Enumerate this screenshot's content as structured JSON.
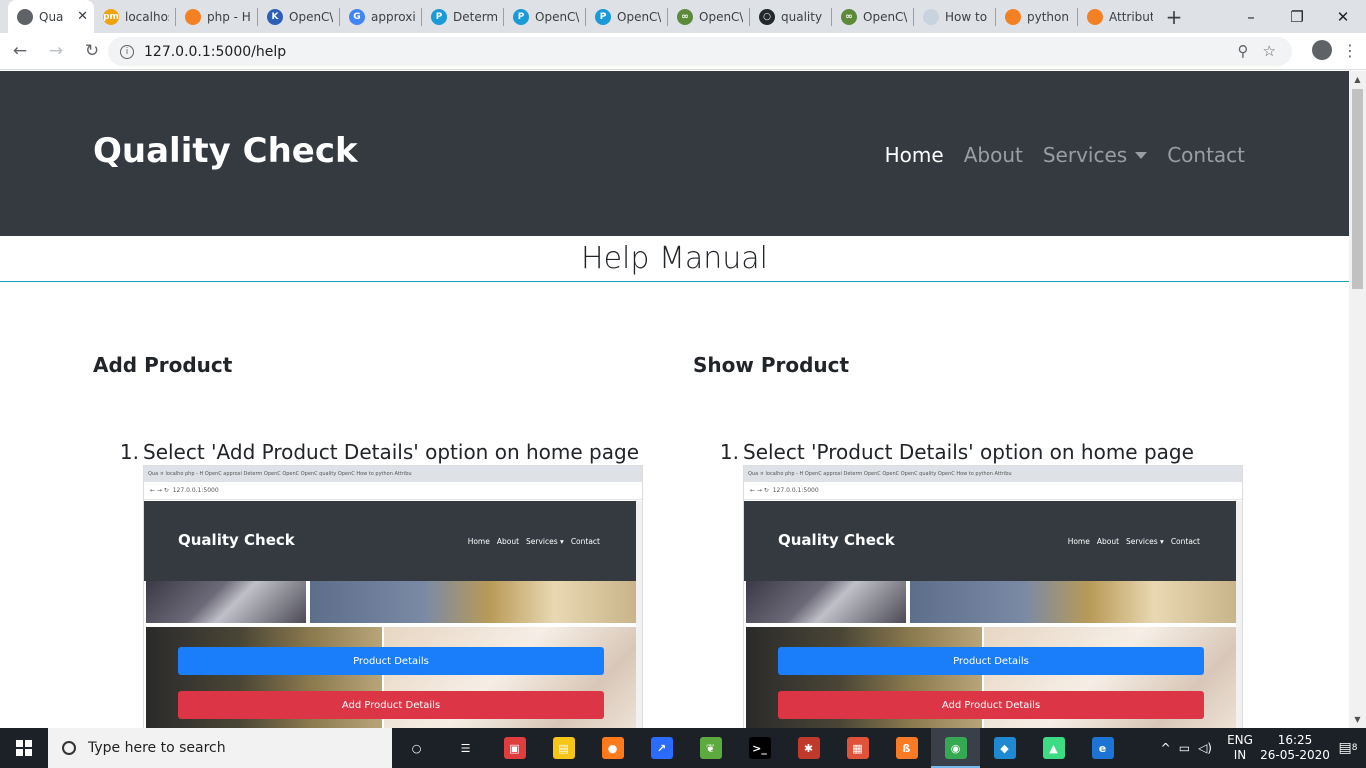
{
  "browser": {
    "tabs": [
      {
        "title": "Qua",
        "active": true,
        "color": "#5f6368",
        "glyph": ""
      },
      {
        "title": "localhos",
        "color": "#f0a20a",
        "glyph": "pm"
      },
      {
        "title": "php - H",
        "color": "#f48024",
        "glyph": ""
      },
      {
        "title": "OpenC\\",
        "color": "#2d5fb6",
        "glyph": "K"
      },
      {
        "title": "approxi",
        "color": "#4285f4",
        "glyph": "G"
      },
      {
        "title": "Determ",
        "color": "#1a9ad6",
        "glyph": "P"
      },
      {
        "title": "OpenC\\",
        "color": "#1a9ad6",
        "glyph": "P"
      },
      {
        "title": "OpenC\\",
        "color": "#1a9ad6",
        "glyph": "P"
      },
      {
        "title": "OpenC\\",
        "color": "#5c8a3a",
        "glyph": "∞"
      },
      {
        "title": "quality",
        "color": "#24292e",
        "glyph": "○"
      },
      {
        "title": "OpenC\\",
        "color": "#5c8a3a",
        "glyph": "∞"
      },
      {
        "title": "How to",
        "color": "#c8d3df",
        "glyph": ""
      },
      {
        "title": "python",
        "color": "#f48024",
        "glyph": ""
      },
      {
        "title": "Attribut",
        "color": "#f48024",
        "glyph": ""
      }
    ],
    "url": "127.0.0.1:5000/help",
    "window_controls": [
      "–",
      "❐",
      "✕"
    ]
  },
  "site": {
    "brand": "Quality Check",
    "nav": {
      "home": "Home",
      "about": "About",
      "services": "Services",
      "contact": "Contact"
    },
    "page_title": "Help Manual",
    "sections": [
      {
        "heading": "Add Product",
        "step_number": "1.",
        "step_text": "Select 'Add Product Details' option on home page"
      },
      {
        "heading": "Show Product",
        "step_number": "1.",
        "step_text": "Select 'Product Details' option on home page"
      }
    ],
    "mini": {
      "url": "127.0.0.1:5000",
      "brand": "Quality Check",
      "links": [
        "Home",
        "About",
        "Services ▾",
        "Contact"
      ],
      "btn_blue": "Product Details",
      "btn_red": "Add Product Details",
      "tab_titles": "Qua  ×   localho   php - H   OpenC   approxi   Determ   OpenC   OpenC   OpenC   quality   OpenC   How to   python   Attribu"
    }
  },
  "taskbar": {
    "search_placeholder": "Type here to search",
    "lang_top": "ENG",
    "lang_bottom": "IN",
    "time": "16:25",
    "date": "26-05-2020",
    "notifications": "8",
    "apps": [
      {
        "name": "cortana",
        "color": "#1c2128",
        "glyph": "○"
      },
      {
        "name": "task-view",
        "color": "#1c2128",
        "glyph": "☰"
      },
      {
        "name": "app-red",
        "color": "#e03e3e",
        "glyph": "▣"
      },
      {
        "name": "file-explorer",
        "color": "#f5c518",
        "glyph": "▤"
      },
      {
        "name": "firefox",
        "color": "#ff7a1a",
        "glyph": "●"
      },
      {
        "name": "app-blue",
        "color": "#2b6cff",
        "glyph": "↗"
      },
      {
        "name": "spring",
        "color": "#5dab3f",
        "glyph": "❦"
      },
      {
        "name": "terminal",
        "color": "#000000",
        "glyph": ">_"
      },
      {
        "name": "app-web",
        "color": "#c0392b",
        "glyph": "✱"
      },
      {
        "name": "app-tools",
        "color": "#e0533a",
        "glyph": "▦"
      },
      {
        "name": "xampp",
        "color": "#fb7a24",
        "glyph": "ß"
      },
      {
        "name": "chrome",
        "color": "#34a853",
        "glyph": "◉",
        "active": true
      },
      {
        "name": "vscode",
        "color": "#1f8ad2",
        "glyph": "◆"
      },
      {
        "name": "android-studio",
        "color": "#3ddc84",
        "glyph": "▲"
      },
      {
        "name": "edge",
        "color": "#1e74d4",
        "glyph": "e"
      }
    ]
  }
}
